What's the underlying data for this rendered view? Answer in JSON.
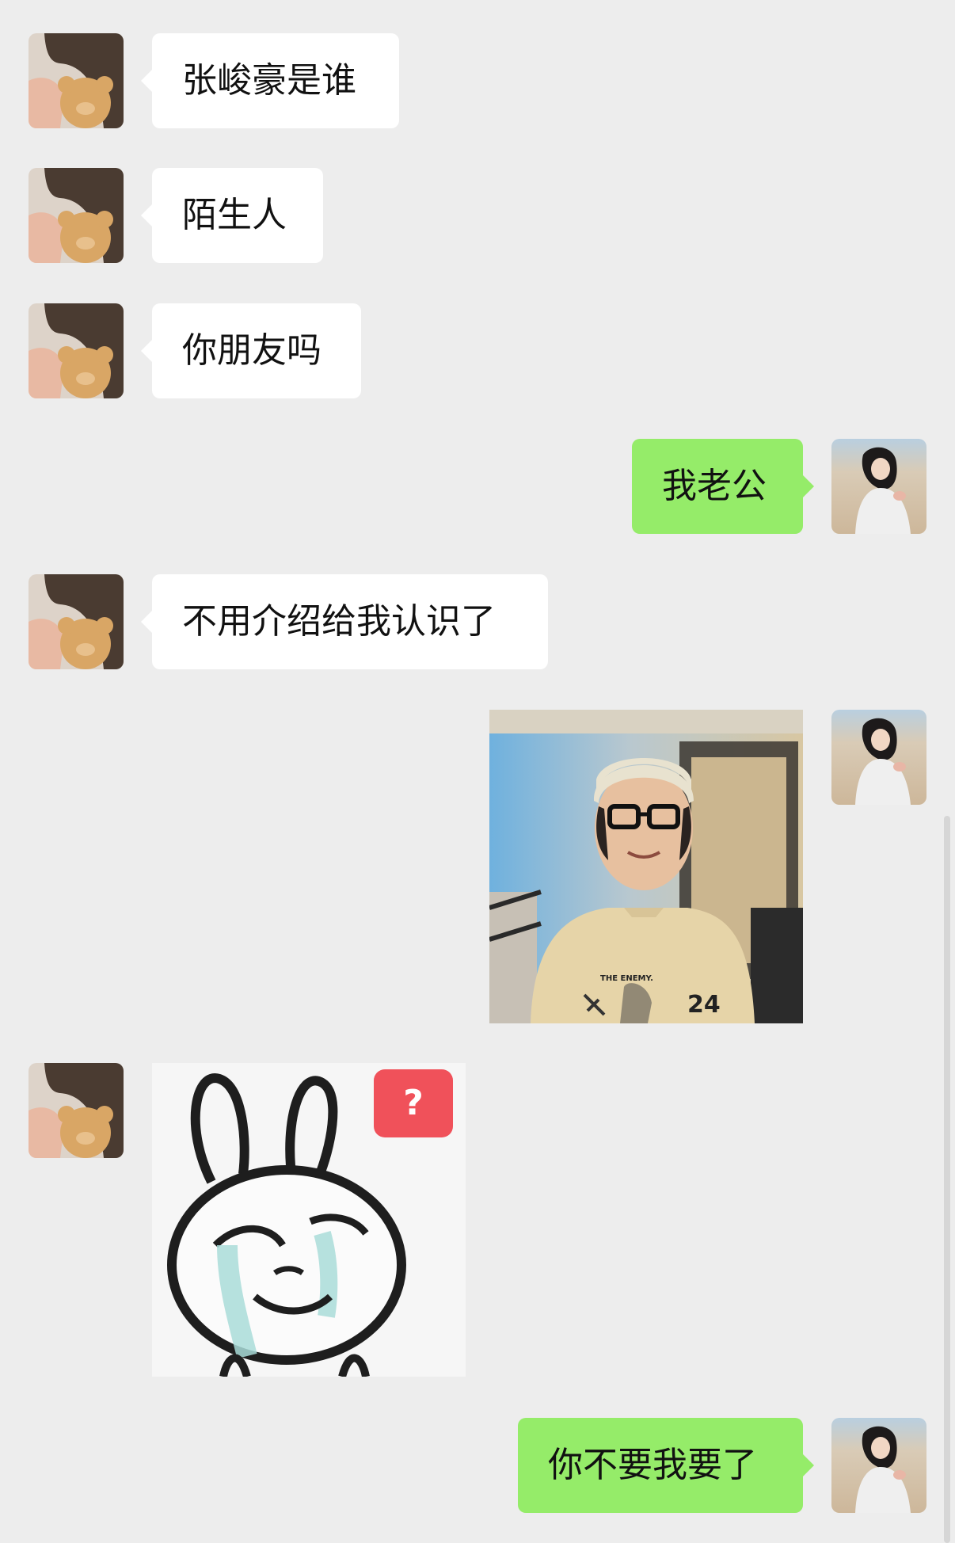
{
  "messages": [
    {
      "side": "left",
      "text": "张峻豪是谁"
    },
    {
      "side": "left",
      "text": "陌生人"
    },
    {
      "side": "left",
      "text": "你朋友吗"
    },
    {
      "side": "right",
      "text": "我老公"
    },
    {
      "side": "left",
      "text": "不用介绍给我认识了"
    },
    {
      "side": "right",
      "kind": "photo",
      "tshirt_text": "THE ENEMY.",
      "tshirt_number": "24"
    },
    {
      "side": "left",
      "kind": "sticker",
      "badge": "?"
    },
    {
      "side": "right",
      "text": "你不要我要了"
    }
  ],
  "colors": {
    "background": "#ededed",
    "incoming_bubble": "#ffffff",
    "outgoing_bubble": "#95ec69",
    "badge": "#f0515a"
  }
}
